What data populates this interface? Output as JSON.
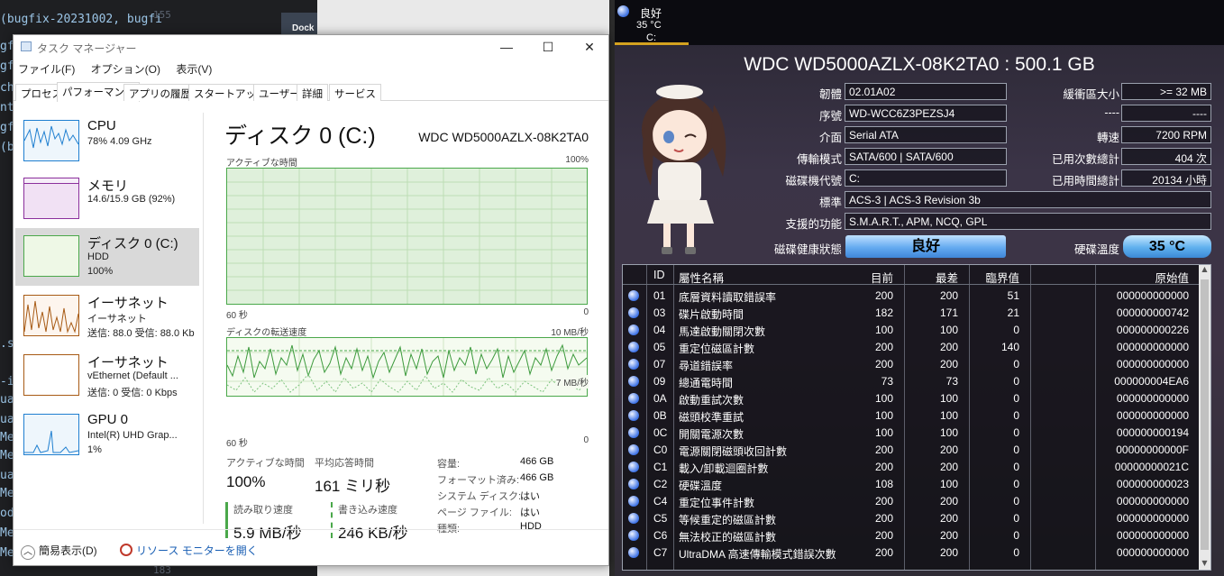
{
  "editor": {
    "tab_label": "Dock",
    "line_numbers": [
      "155",
      "183"
    ],
    "lines": [
      "(bugfix-20231002, bugfi",
      "gf",
      "gf",
      "ch",
      "nt",
      "gf",
      "(b",
      ".s",
      "-i",
      "ua",
      "ua",
      "Me",
      "Me",
      "ua",
      "Me",
      "od",
      "Me",
      "Me"
    ]
  },
  "taskmgr": {
    "title": "タスク マネージャー",
    "window_controls": {
      "minimize": "—",
      "maximize": "☐",
      "close": "✕"
    },
    "menu": [
      "ファイル(F)",
      "オプション(O)",
      "表示(V)"
    ],
    "tabs": [
      "プロセス",
      "パフォーマンス",
      "アプリの履歴",
      "スタートアップ",
      "ユーザー",
      "詳細",
      "サービス"
    ],
    "active_tab": "パフォーマンス",
    "left_items": [
      {
        "title": "CPU",
        "line1": "78%  4.09 GHz",
        "line2": "",
        "color": "#1f7fd0"
      },
      {
        "title": "メモリ",
        "line1": "14.6/15.9 GB (92%)",
        "line2": "",
        "color": "#8b2f9c"
      },
      {
        "title": "ディスク 0 (C:)",
        "line1": "HDD",
        "line2": "100%",
        "color": "#4aa84a"
      },
      {
        "title": "イーサネット",
        "line1": "イーサネット",
        "line2": "送信: 88.0  受信: 88.0 Kb",
        "color": "#a75a14"
      },
      {
        "title": "イーサネット",
        "line1": "vEthernet (Default ...",
        "line2": "送信: 0  受信: 0 Kbps",
        "color": "#a75a14"
      },
      {
        "title": "GPU 0",
        "line1": "Intel(R) UHD Grap...",
        "line2": "1%",
        "color": "#1f7fd0"
      }
    ],
    "disk": {
      "title": "ディスク 0 (C:)",
      "model": "WDC WD5000AZLX-08K2TA0",
      "graph1_label": "アクティブな時間",
      "graph1_max": "100%",
      "graph1_time": "60 秒",
      "graph1_min": "0",
      "graph1_active_percent": 100,
      "graph2_label": "ディスクの転送速度",
      "graph2_max": "10 MB/秒",
      "graph2_line": "7 MB/秒",
      "graph2_time": "60 秒",
      "graph2_min": "0",
      "stats": {
        "active_time_label": "アクティブな時間",
        "active_time": "100%",
        "avg_response_label": "平均応答時間",
        "avg_response": "161 ミリ秒",
        "read_label": "読み取り速度",
        "read": "5.9 MB/秒",
        "write_label": "書き込み速度",
        "write": "246 KB/秒"
      },
      "props": [
        {
          "label": "容量:",
          "value": "466 GB"
        },
        {
          "label": "フォーマット済み:",
          "value": "466 GB"
        },
        {
          "label": "システム ディスク:",
          "value": "はい"
        },
        {
          "label": "ページ ファイル:",
          "value": "はい"
        },
        {
          "label": "種類:",
          "value": "HDD"
        }
      ]
    },
    "footer": {
      "fewer_details": "簡易表示(D)",
      "resource_monitor": "リソース モニターを開く"
    }
  },
  "cdi": {
    "drive_tab": {
      "status": "良好",
      "temp": "35 °C",
      "letter": "C:"
    },
    "title": "WDC WD5000AZLX-08K2TA0 : 500.1 GB",
    "fields_left": [
      {
        "label": "韌體",
        "value": "02.01A02"
      },
      {
        "label": "序號",
        "value": "WD-WCC6Z3PEZSJ4"
      },
      {
        "label": "介面",
        "value": "Serial ATA"
      },
      {
        "label": "傳輸模式",
        "value": "SATA/600 | SATA/600"
      },
      {
        "label": "磁碟機代號",
        "value": "C:"
      }
    ],
    "fields_wide": [
      {
        "label": "標準",
        "value": "ACS-3 | ACS-3 Revision 3b"
      },
      {
        "label": "支援的功能",
        "value": "S.M.A.R.T., APM, NCQ, GPL"
      }
    ],
    "fields_right": [
      {
        "label": "緩衝區大小",
        "value": ">= 32 MB"
      },
      {
        "label": "----",
        "value": "----"
      },
      {
        "label": "轉速",
        "value": "7200 RPM"
      },
      {
        "label": "已用次數總計",
        "value": "404 次"
      },
      {
        "label": "已用時間總計",
        "value": "20134 小時"
      }
    ],
    "health_label": "磁碟健康狀態",
    "health_value": "良好",
    "temp_label": "硬碟溫度",
    "temp_value": "35 °C",
    "table_headers": {
      "id": "ID",
      "name": "屬性名稱",
      "current": "目前",
      "worst": "最差",
      "threshold": "臨界值",
      "raw": "原始值"
    },
    "attributes": [
      {
        "id": "01",
        "name": "底層資料讀取錯誤率",
        "current": "200",
        "worst": "200",
        "threshold": "51",
        "raw": "000000000000"
      },
      {
        "id": "03",
        "name": "碟片啟動時間",
        "current": "182",
        "worst": "171",
        "threshold": "21",
        "raw": "000000000742"
      },
      {
        "id": "04",
        "name": "馬達啟動關閉次數",
        "current": "100",
        "worst": "100",
        "threshold": "0",
        "raw": "000000000226"
      },
      {
        "id": "05",
        "name": "重定位磁區計數",
        "current": "200",
        "worst": "200",
        "threshold": "140",
        "raw": "000000000000"
      },
      {
        "id": "07",
        "name": "尋道錯誤率",
        "current": "200",
        "worst": "200",
        "threshold": "0",
        "raw": "000000000000"
      },
      {
        "id": "09",
        "name": "總通電時間",
        "current": "73",
        "worst": "73",
        "threshold": "0",
        "raw": "000000004EA6"
      },
      {
        "id": "0A",
        "name": "啟動重試次數",
        "current": "100",
        "worst": "100",
        "threshold": "0",
        "raw": "000000000000"
      },
      {
        "id": "0B",
        "name": "磁頭校準重試",
        "current": "100",
        "worst": "100",
        "threshold": "0",
        "raw": "000000000000"
      },
      {
        "id": "0C",
        "name": "開關電源次數",
        "current": "100",
        "worst": "100",
        "threshold": "0",
        "raw": "000000000194"
      },
      {
        "id": "C0",
        "name": "電源關閉磁頭收回計數",
        "current": "200",
        "worst": "200",
        "threshold": "0",
        "raw": "00000000000F"
      },
      {
        "id": "C1",
        "name": "載入/卸載迴圈計數",
        "current": "200",
        "worst": "200",
        "threshold": "0",
        "raw": "00000000021C"
      },
      {
        "id": "C2",
        "name": "硬碟溫度",
        "current": "108",
        "worst": "100",
        "threshold": "0",
        "raw": "000000000023"
      },
      {
        "id": "C4",
        "name": "重定位事件計數",
        "current": "200",
        "worst": "200",
        "threshold": "0",
        "raw": "000000000000"
      },
      {
        "id": "C5",
        "name": "等候重定的磁區計數",
        "current": "200",
        "worst": "200",
        "threshold": "0",
        "raw": "000000000000"
      },
      {
        "id": "C6",
        "name": "無法校正的磁區計數",
        "current": "200",
        "worst": "200",
        "threshold": "0",
        "raw": "000000000000"
      },
      {
        "id": "C7",
        "name": "UltraDMA 高速傳輸模式錯誤次數",
        "current": "200",
        "worst": "200",
        "threshold": "0",
        "raw": "000000000000"
      }
    ],
    "colors": {
      "status_good": "#3d72e6",
      "accent": "#d4a21f"
    }
  }
}
